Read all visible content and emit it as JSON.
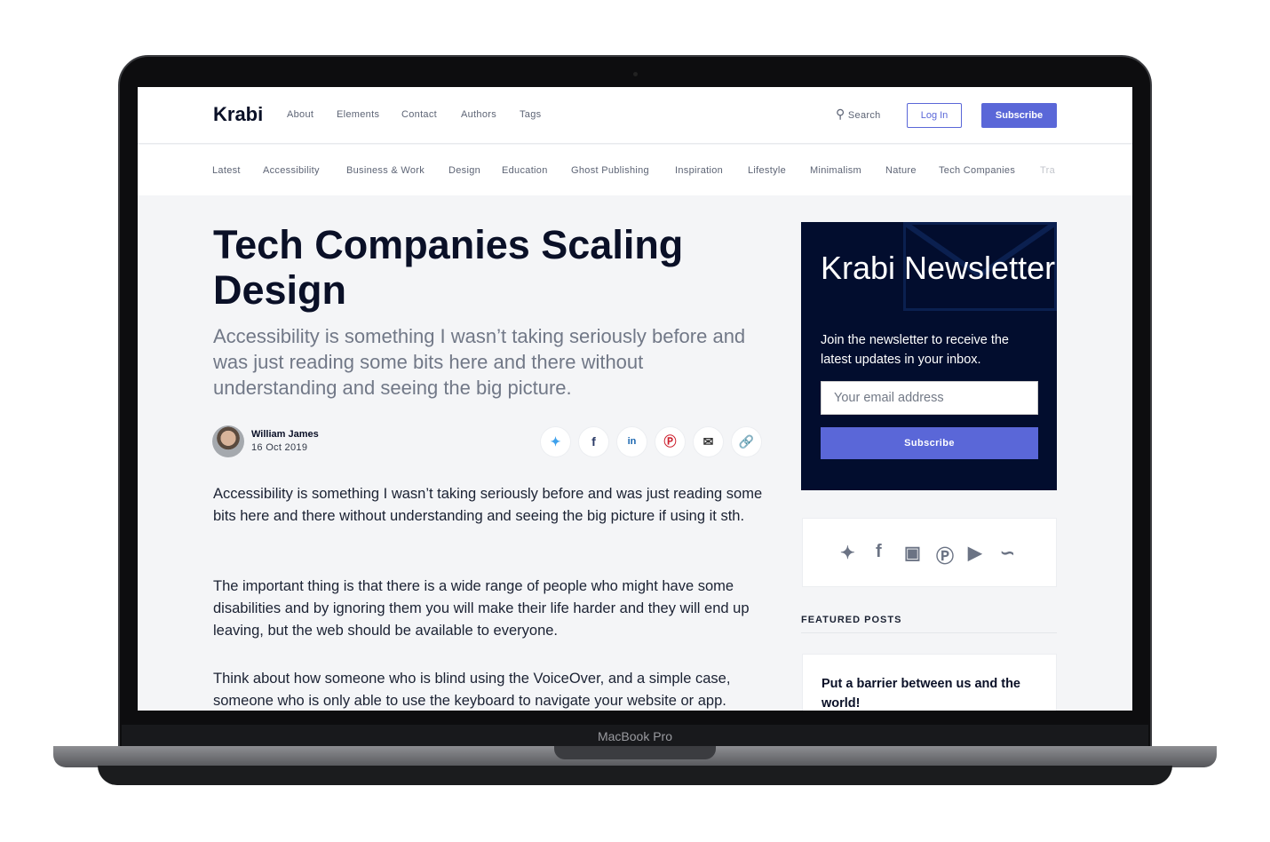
{
  "device_label": "MacBook Pro",
  "header": {
    "logo": "Krabi",
    "nav": [
      "About",
      "Elements",
      "Contact",
      "Authors",
      "Tags"
    ],
    "search": "Search",
    "login": "Log In",
    "subscribe": "Subscribe"
  },
  "categories": [
    "Latest",
    "Accessibility",
    "Business & Work",
    "Design",
    "Education",
    "Ghost Publishing",
    "Inspiration",
    "Lifestyle",
    "Minimalism",
    "Nature",
    "Tech Companies",
    "Tra"
  ],
  "article": {
    "title": "Tech Companies Scaling Design",
    "excerpt": "Accessibility is something I wasn’t taking seriously before and was just reading some bits here and there without understanding and seeing the big picture.",
    "author": "William James",
    "date": "16 Oct 2019",
    "share_icons": [
      "twitter-icon",
      "facebook-icon",
      "linkedin-icon",
      "pinterest-icon",
      "email-icon",
      "link-icon"
    ],
    "paragraphs": [
      "Accessibility is something I wasn’t taking seriously before and was just reading some bits here and there without understanding and seeing the big picture if using it sth.",
      "The important thing is that there is a wide range of people who might have some disabilities and by ignoring them you will make their life harder and they will end up leaving, but the web should be available to everyone.",
      "Think about how someone who is blind using the VoiceOver, and a simple case, someone who is only able to use the keyboard to navigate your website or app."
    ]
  },
  "newsletter": {
    "title": "Krabi Newsletter",
    "description": "Join the newsletter to receive the latest updates in your inbox.",
    "placeholder": "Your email address",
    "button": "Subscribe"
  },
  "social_icons": [
    "twitter-icon",
    "facebook-icon",
    "instagram-icon",
    "pinterest-icon",
    "youtube-icon",
    "rss-icon"
  ],
  "featured": {
    "label": "FEATURED POSTS",
    "posts": [
      "Put a barrier between us and the world!"
    ]
  },
  "colors": {
    "accent": "#5a67d8",
    "newsletter_bg": "#020d2e"
  }
}
